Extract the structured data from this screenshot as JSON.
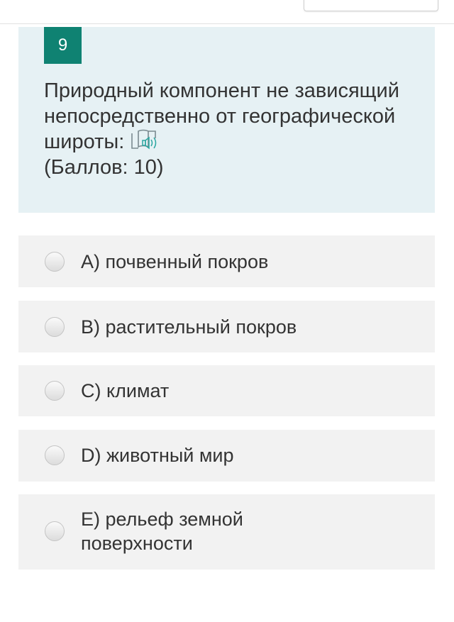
{
  "question": {
    "number": "9",
    "text": "Природный компонент не зависящий непосредственно от географической широты:",
    "points": "(Баллов: 10)"
  },
  "options": [
    {
      "label": "A) почвенный покров"
    },
    {
      "label": "B) растительный покров"
    },
    {
      "label": "C) климат"
    },
    {
      "label": "D) животный мир"
    },
    {
      "label": "E) рельеф земной поверхности"
    }
  ],
  "colors": {
    "accent": "#0f8272",
    "question_bg": "#e6f1f4",
    "option_bg": "#f2f2f2"
  },
  "icons": {
    "audio": "read-aloud-icon"
  }
}
